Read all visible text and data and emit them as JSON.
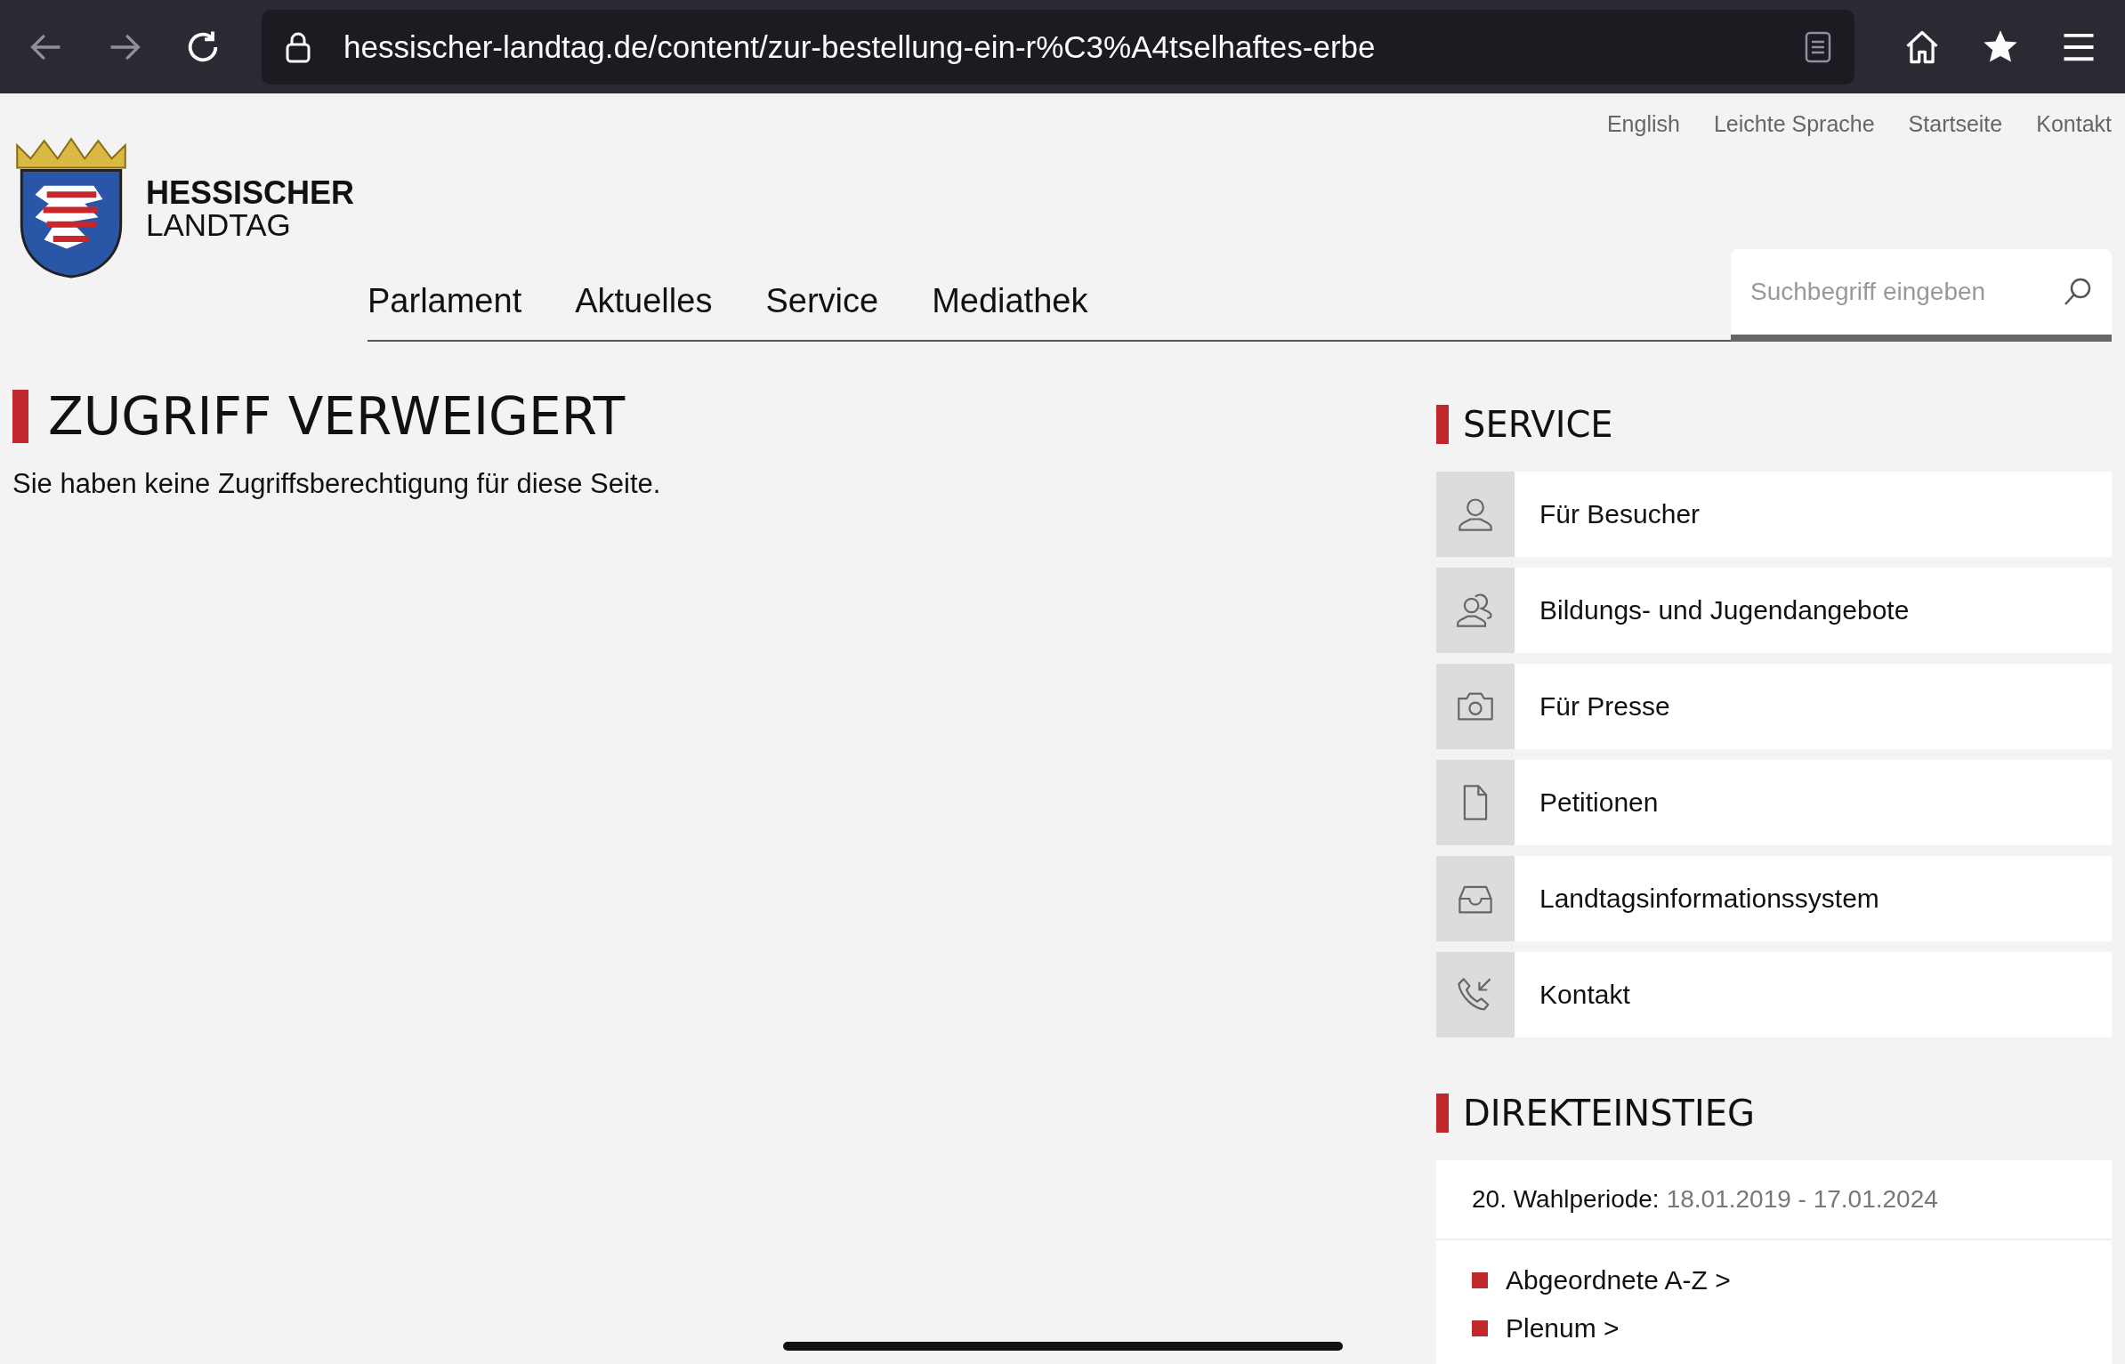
{
  "browser": {
    "url": "hessischer-landtag.de/content/zur-bestellung-ein-r%C3%A4tselhaftes-erbe"
  },
  "utility_links": [
    "English",
    "Leichte Sprache",
    "Startseite",
    "Kontakt"
  ],
  "logo": {
    "line_1": "HESSISCHER",
    "line_2": "LANDTAG"
  },
  "nav": [
    "Parlament",
    "Aktuelles",
    "Service",
    "Mediathek"
  ],
  "search": {
    "placeholder": "Suchbegriff eingeben"
  },
  "main": {
    "title": "ZUGRIFF VERWEIGERT",
    "message": "Sie haben keine Zugriffsberechtigung für diese Seite."
  },
  "service": {
    "title": "SERVICE",
    "items": [
      {
        "label": "Für Besucher",
        "kind": "person"
      },
      {
        "label": "Bildungs- und Jugendangebote",
        "kind": "people"
      },
      {
        "label": "Für Presse",
        "kind": "camera"
      },
      {
        "label": "Petitionen",
        "kind": "document"
      },
      {
        "label": "Landtagsinformationssystem",
        "kind": "tray"
      },
      {
        "label": "Kontakt",
        "kind": "phone"
      }
    ]
  },
  "direct": {
    "title": "DIREKTEINSTIEG",
    "period_label": "20. Wahlperiode:",
    "period_dates": "18.01.2019 - 17.01.2024",
    "links": [
      "Abgeordnete A-Z >",
      "Plenum >"
    ]
  }
}
